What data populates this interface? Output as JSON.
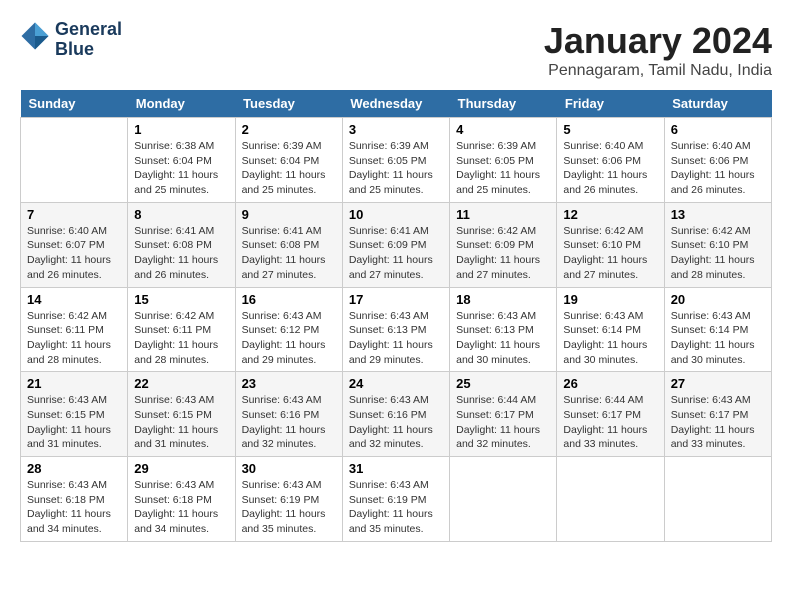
{
  "header": {
    "logo": {
      "line1": "General",
      "line2": "Blue"
    },
    "title": "January 2024",
    "subtitle": "Pennagaram, Tamil Nadu, India"
  },
  "weekdays": [
    "Sunday",
    "Monday",
    "Tuesday",
    "Wednesday",
    "Thursday",
    "Friday",
    "Saturday"
  ],
  "weeks": [
    [
      {
        "day": "",
        "sunrise": "",
        "sunset": "",
        "daylight": ""
      },
      {
        "day": "1",
        "sunrise": "Sunrise: 6:38 AM",
        "sunset": "Sunset: 6:04 PM",
        "daylight": "Daylight: 11 hours and 25 minutes."
      },
      {
        "day": "2",
        "sunrise": "Sunrise: 6:39 AM",
        "sunset": "Sunset: 6:04 PM",
        "daylight": "Daylight: 11 hours and 25 minutes."
      },
      {
        "day": "3",
        "sunrise": "Sunrise: 6:39 AM",
        "sunset": "Sunset: 6:05 PM",
        "daylight": "Daylight: 11 hours and 25 minutes."
      },
      {
        "day": "4",
        "sunrise": "Sunrise: 6:39 AM",
        "sunset": "Sunset: 6:05 PM",
        "daylight": "Daylight: 11 hours and 25 minutes."
      },
      {
        "day": "5",
        "sunrise": "Sunrise: 6:40 AM",
        "sunset": "Sunset: 6:06 PM",
        "daylight": "Daylight: 11 hours and 26 minutes."
      },
      {
        "day": "6",
        "sunrise": "Sunrise: 6:40 AM",
        "sunset": "Sunset: 6:06 PM",
        "daylight": "Daylight: 11 hours and 26 minutes."
      }
    ],
    [
      {
        "day": "7",
        "sunrise": "Sunrise: 6:40 AM",
        "sunset": "Sunset: 6:07 PM",
        "daylight": "Daylight: 11 hours and 26 minutes."
      },
      {
        "day": "8",
        "sunrise": "Sunrise: 6:41 AM",
        "sunset": "Sunset: 6:08 PM",
        "daylight": "Daylight: 11 hours and 26 minutes."
      },
      {
        "day": "9",
        "sunrise": "Sunrise: 6:41 AM",
        "sunset": "Sunset: 6:08 PM",
        "daylight": "Daylight: 11 hours and 27 minutes."
      },
      {
        "day": "10",
        "sunrise": "Sunrise: 6:41 AM",
        "sunset": "Sunset: 6:09 PM",
        "daylight": "Daylight: 11 hours and 27 minutes."
      },
      {
        "day": "11",
        "sunrise": "Sunrise: 6:42 AM",
        "sunset": "Sunset: 6:09 PM",
        "daylight": "Daylight: 11 hours and 27 minutes."
      },
      {
        "day": "12",
        "sunrise": "Sunrise: 6:42 AM",
        "sunset": "Sunset: 6:10 PM",
        "daylight": "Daylight: 11 hours and 27 minutes."
      },
      {
        "day": "13",
        "sunrise": "Sunrise: 6:42 AM",
        "sunset": "Sunset: 6:10 PM",
        "daylight": "Daylight: 11 hours and 28 minutes."
      }
    ],
    [
      {
        "day": "14",
        "sunrise": "Sunrise: 6:42 AM",
        "sunset": "Sunset: 6:11 PM",
        "daylight": "Daylight: 11 hours and 28 minutes."
      },
      {
        "day": "15",
        "sunrise": "Sunrise: 6:42 AM",
        "sunset": "Sunset: 6:11 PM",
        "daylight": "Daylight: 11 hours and 28 minutes."
      },
      {
        "day": "16",
        "sunrise": "Sunrise: 6:43 AM",
        "sunset": "Sunset: 6:12 PM",
        "daylight": "Daylight: 11 hours and 29 minutes."
      },
      {
        "day": "17",
        "sunrise": "Sunrise: 6:43 AM",
        "sunset": "Sunset: 6:13 PM",
        "daylight": "Daylight: 11 hours and 29 minutes."
      },
      {
        "day": "18",
        "sunrise": "Sunrise: 6:43 AM",
        "sunset": "Sunset: 6:13 PM",
        "daylight": "Daylight: 11 hours and 30 minutes."
      },
      {
        "day": "19",
        "sunrise": "Sunrise: 6:43 AM",
        "sunset": "Sunset: 6:14 PM",
        "daylight": "Daylight: 11 hours and 30 minutes."
      },
      {
        "day": "20",
        "sunrise": "Sunrise: 6:43 AM",
        "sunset": "Sunset: 6:14 PM",
        "daylight": "Daylight: 11 hours and 30 minutes."
      }
    ],
    [
      {
        "day": "21",
        "sunrise": "Sunrise: 6:43 AM",
        "sunset": "Sunset: 6:15 PM",
        "daylight": "Daylight: 11 hours and 31 minutes."
      },
      {
        "day": "22",
        "sunrise": "Sunrise: 6:43 AM",
        "sunset": "Sunset: 6:15 PM",
        "daylight": "Daylight: 11 hours and 31 minutes."
      },
      {
        "day": "23",
        "sunrise": "Sunrise: 6:43 AM",
        "sunset": "Sunset: 6:16 PM",
        "daylight": "Daylight: 11 hours and 32 minutes."
      },
      {
        "day": "24",
        "sunrise": "Sunrise: 6:43 AM",
        "sunset": "Sunset: 6:16 PM",
        "daylight": "Daylight: 11 hours and 32 minutes."
      },
      {
        "day": "25",
        "sunrise": "Sunrise: 6:44 AM",
        "sunset": "Sunset: 6:17 PM",
        "daylight": "Daylight: 11 hours and 32 minutes."
      },
      {
        "day": "26",
        "sunrise": "Sunrise: 6:44 AM",
        "sunset": "Sunset: 6:17 PM",
        "daylight": "Daylight: 11 hours and 33 minutes."
      },
      {
        "day": "27",
        "sunrise": "Sunrise: 6:43 AM",
        "sunset": "Sunset: 6:17 PM",
        "daylight": "Daylight: 11 hours and 33 minutes."
      }
    ],
    [
      {
        "day": "28",
        "sunrise": "Sunrise: 6:43 AM",
        "sunset": "Sunset: 6:18 PM",
        "daylight": "Daylight: 11 hours and 34 minutes."
      },
      {
        "day": "29",
        "sunrise": "Sunrise: 6:43 AM",
        "sunset": "Sunset: 6:18 PM",
        "daylight": "Daylight: 11 hours and 34 minutes."
      },
      {
        "day": "30",
        "sunrise": "Sunrise: 6:43 AM",
        "sunset": "Sunset: 6:19 PM",
        "daylight": "Daylight: 11 hours and 35 minutes."
      },
      {
        "day": "31",
        "sunrise": "Sunrise: 6:43 AM",
        "sunset": "Sunset: 6:19 PM",
        "daylight": "Daylight: 11 hours and 35 minutes."
      },
      {
        "day": "",
        "sunrise": "",
        "sunset": "",
        "daylight": ""
      },
      {
        "day": "",
        "sunrise": "",
        "sunset": "",
        "daylight": ""
      },
      {
        "day": "",
        "sunrise": "",
        "sunset": "",
        "daylight": ""
      }
    ]
  ]
}
